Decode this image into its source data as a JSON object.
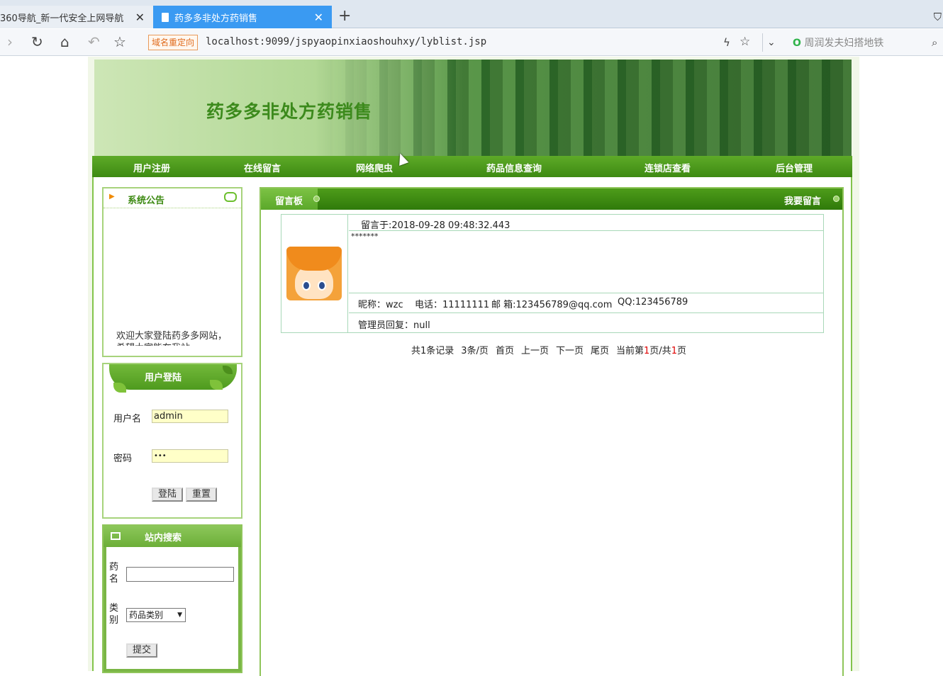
{
  "browser": {
    "tabs": [
      {
        "title": "360导航_新一代安全上网导航",
        "active": false
      },
      {
        "title": "药多多非处方药销售",
        "active": true
      }
    ],
    "redirect_badge": "域名重定向",
    "url": "localhost:9099/jspyaopinxiaoshouhxy/lyblist.jsp",
    "news_ticker": "周润发夫妇搭地铁"
  },
  "site": {
    "title": "药多多非处方药销售",
    "nav": [
      "用户注册",
      "在线留言",
      "网络爬虫",
      "药品信息查询",
      "连锁店查看",
      "后台管理"
    ]
  },
  "notice": {
    "title": "系统公告",
    "text": "欢迎大家登陆药多多网站，希望大家能在我站"
  },
  "login": {
    "title": "用户登陆",
    "username_label": "用户名",
    "username_value": "admin",
    "password_label": "密码",
    "password_value": "•••",
    "login_button": "登陆",
    "reset_button": "重置"
  },
  "search": {
    "title": "站内搜索",
    "name_label": "药名",
    "category_label": "类别",
    "category_selected": "药品类别",
    "submit_button": "提交"
  },
  "board": {
    "title": "留言板",
    "post_link": "我要留言",
    "message": {
      "posted_at": "留言于:2018-09-28 09:48:32.443",
      "content": "*******",
      "nickname": "昵称：wzc",
      "phone": "电话：11111111",
      "email": "邮 箱:123456789@qq.com",
      "qq": "QQ:123456789",
      "reply": "管理员回复：null"
    },
    "pager": {
      "total": "共1条记录",
      "per_page": "3条/页",
      "first": "首页",
      "prev": "上一页",
      "next": "下一页",
      "last": "尾页",
      "current_prefix": "当前第",
      "current_page": "1",
      "current_mid": "页/共",
      "total_pages": "1",
      "current_suffix": "页"
    }
  }
}
